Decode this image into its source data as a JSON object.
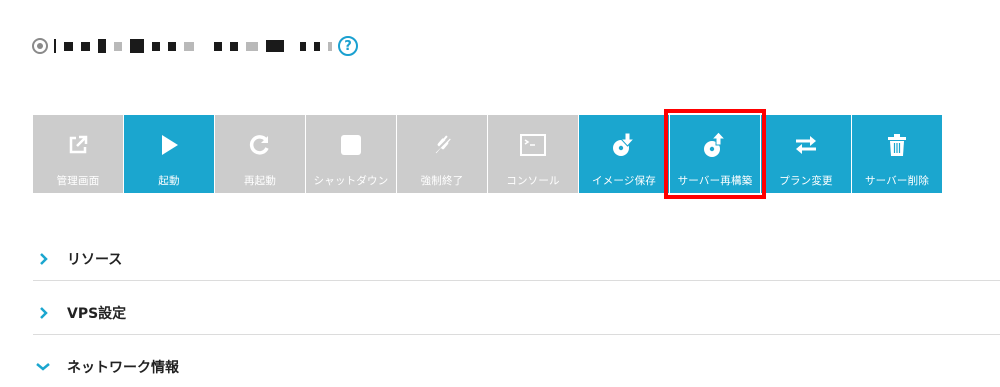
{
  "header": {
    "server_name_masked": "",
    "help_icon": "question-circle-icon",
    "help_symbol": "?"
  },
  "toolbar": {
    "buttons": [
      {
        "label": "管理画面",
        "icon": "external-link-icon",
        "state": "disabled"
      },
      {
        "label": "起動",
        "icon": "play-icon",
        "state": "active"
      },
      {
        "label": "再起動",
        "icon": "restart-icon",
        "state": "disabled"
      },
      {
        "label": "シャットダウン",
        "icon": "stop-icon",
        "state": "disabled"
      },
      {
        "label": "強制終了",
        "icon": "plug-off-icon",
        "state": "disabled"
      },
      {
        "label": "コンソール",
        "icon": "console-icon",
        "state": "disabled"
      },
      {
        "label": "イメージ保存",
        "icon": "disk-download-icon",
        "state": "active"
      },
      {
        "label": "サーバー再構築",
        "icon": "disk-upload-icon",
        "state": "active",
        "highlighted": true
      },
      {
        "label": "プラン変更",
        "icon": "swap-arrows-icon",
        "state": "active"
      },
      {
        "label": "サーバー削除",
        "icon": "trash-icon",
        "state": "active"
      }
    ]
  },
  "sections": [
    {
      "label": "リソース",
      "expanded": false
    },
    {
      "label": "VPS設定",
      "expanded": false
    },
    {
      "label": "ネットワーク情報",
      "expanded": true
    }
  ],
  "colors": {
    "accent": "#1ba6cf",
    "disabled": "#cccccc",
    "highlight": "#ff0000"
  }
}
